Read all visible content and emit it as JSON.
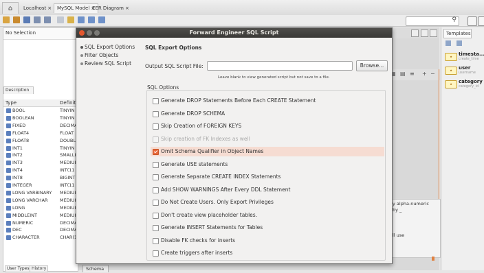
{
  "tabs": {
    "localhost": "Localhost",
    "model": "MySQL Model",
    "eer": "EER Diagram",
    "close": "×"
  },
  "left_panel": {
    "selection": "No Selection",
    "description_tab": "Description",
    "columns": {
      "type": "Type",
      "definition": "Definiti"
    },
    "rows": [
      {
        "name": "BOOL",
        "def": "TINYIN"
      },
      {
        "name": "BOOLEAN",
        "def": "TINYIN"
      },
      {
        "name": "FIXED",
        "def": "DECIMA"
      },
      {
        "name": "FLOAT4",
        "def": "FLOAT"
      },
      {
        "name": "FLOAT8",
        "def": "DOUBL"
      },
      {
        "name": "INT1",
        "def": "TINYIN"
      },
      {
        "name": "INT2",
        "def": "SMALLI"
      },
      {
        "name": "INT3",
        "def": "MEDIUI"
      },
      {
        "name": "INT4",
        "def": "INT(11"
      },
      {
        "name": "INT8",
        "def": "BIGINT"
      },
      {
        "name": "INTEGER",
        "def": "INT(11"
      },
      {
        "name": "LONG VARBINARY",
        "def": "MEDIUI"
      },
      {
        "name": "LONG VARCHAR",
        "def": "MEDIUI"
      },
      {
        "name": "LONG",
        "def": "MEDIUI"
      },
      {
        "name": "MIDDLEINT",
        "def": "MEDIUI"
      },
      {
        "name": "NUMERIC",
        "def": "DECIMA"
      },
      {
        "name": "DEC",
        "def": "DECIMA"
      },
      {
        "name": "CHARACTER",
        "def": "CHAR(1"
      }
    ],
    "bottom_tabs": {
      "user_types": "User Types",
      "history": "History"
    }
  },
  "center": {
    "partial_line1": "y alpha-numeric",
    "partial_line2": "by _",
    "partial_line3": "ll use",
    "schema_tab": "Schema"
  },
  "templates": {
    "tab": "Templates",
    "items": [
      {
        "name": "timesta...",
        "sub": "create_time"
      },
      {
        "name": "user",
        "sub": "username"
      },
      {
        "name": "category",
        "sub": "category_id"
      }
    ]
  },
  "dialog": {
    "title": "Forward Engineer SQL Script",
    "nav": [
      "SQL Export Options",
      "Filter Objects",
      "Review SQL Script"
    ],
    "section_title": "SQL Export Options",
    "file_label": "Output SQL Script File:",
    "file_value": "",
    "browse": "Browse...",
    "hint": "Leave blank to view generated script but not save to a file.",
    "options_label": "SQL Options",
    "options": [
      {
        "label": "Generate DROP Statements Before Each CREATE Statement",
        "checked": false,
        "disabled": false
      },
      {
        "label": "Generate DROP SCHEMA",
        "checked": false,
        "disabled": false
      },
      {
        "label": "Skip Creation of FOREIGN KEYS",
        "checked": false,
        "disabled": false
      },
      {
        "label": "Skip creation of FK Indexes as well",
        "checked": false,
        "disabled": true
      },
      {
        "label": "Omit Schema Qualifier in Object Names",
        "checked": true,
        "disabled": false
      },
      {
        "label": "Generate USE statements",
        "checked": false,
        "disabled": false
      },
      {
        "label": "Generate Separate CREATE INDEX Statements",
        "checked": false,
        "disabled": false
      },
      {
        "label": "Add SHOW WARNINGS After Every DDL Statement",
        "checked": false,
        "disabled": false
      },
      {
        "label": "Do Not Create Users. Only Export Privileges",
        "checked": false,
        "disabled": false
      },
      {
        "label": "Don't create view placeholder tables.",
        "checked": false,
        "disabled": false
      },
      {
        "label": "Generate INSERT Statements for Tables",
        "checked": false,
        "disabled": false
      },
      {
        "label": "Disable FK checks for inserts",
        "checked": false,
        "disabled": false
      },
      {
        "label": "Create triggers after inserts",
        "checked": false,
        "disabled": false
      }
    ]
  },
  "colors": {
    "accent": "#e9693b",
    "titlebar": "#3a3936"
  }
}
